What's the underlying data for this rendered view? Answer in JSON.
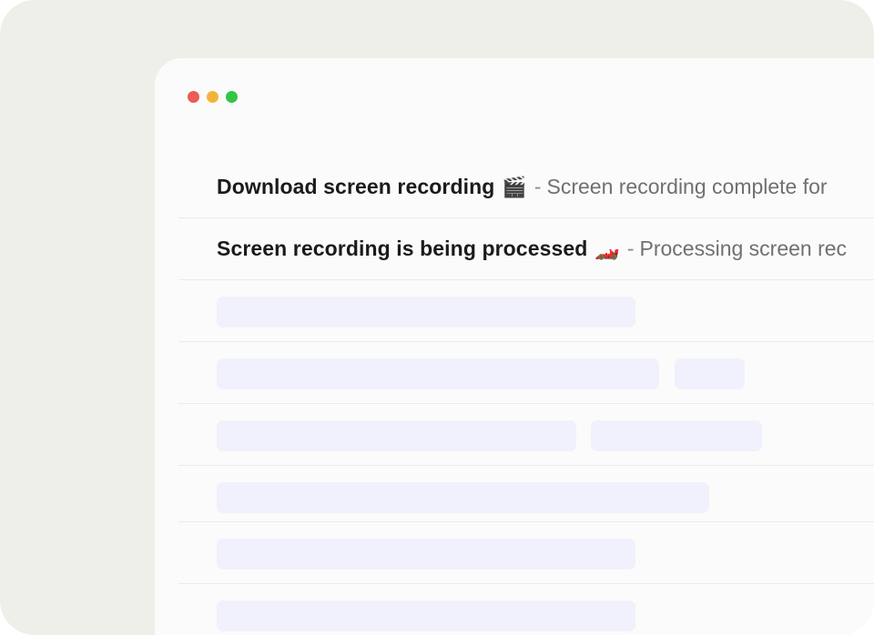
{
  "window": {
    "traffic_lights": [
      {
        "name": "close",
        "color": "#ee5a55"
      },
      {
        "name": "minimize",
        "color": "#f2b43c"
      },
      {
        "name": "maximize",
        "color": "#33c548"
      }
    ]
  },
  "messages": [
    {
      "subject": "Download screen recording",
      "emoji": "🎬",
      "emoji_icon": "clapper-board-icon",
      "separator": "-",
      "preview": "Screen recording complete for"
    },
    {
      "subject": "Screen recording is being processed",
      "emoji": "🏎️",
      "emoji_icon": "racing-car-icon",
      "separator": "-",
      "preview": "Processing screen rec"
    }
  ],
  "placeholder_color": "#f1f1fd"
}
